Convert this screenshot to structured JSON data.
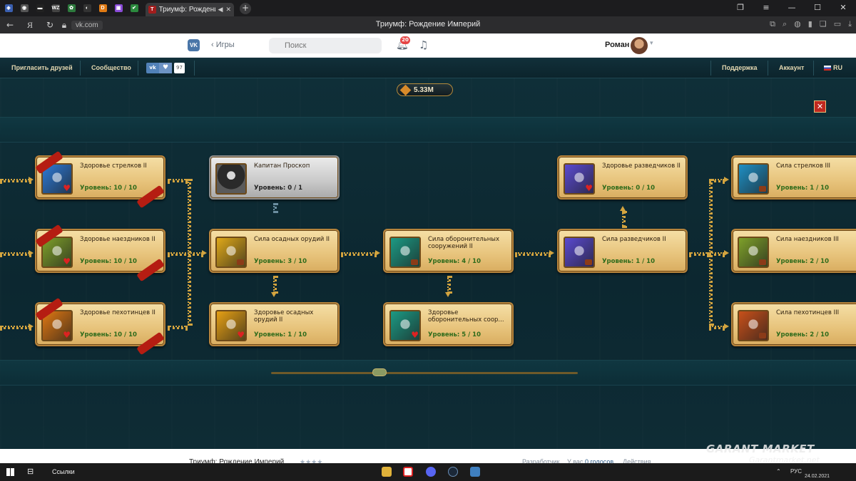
{
  "browser": {
    "pinned_tabs": [
      {
        "icon": "shield-icon",
        "glyph": "◈",
        "color": "#3a5fb0"
      },
      {
        "icon": "chrome-icon",
        "glyph": "◉",
        "color": "#555"
      },
      {
        "icon": "bar-icon",
        "glyph": "▬",
        "color": "#222"
      },
      {
        "icon": "wz-icon",
        "glyph": "WZ",
        "color": "#444"
      },
      {
        "icon": "leaf-icon",
        "glyph": "✿",
        "color": "#2d7a3d"
      },
      {
        "icon": "mask-icon",
        "glyph": "◐",
        "color": "#333"
      },
      {
        "icon": "dns-icon",
        "glyph": "DNS",
        "color": "#e07a13"
      },
      {
        "icon": "twitch-icon",
        "glyph": "▣",
        "color": "#8a4bd8"
      },
      {
        "icon": "check-icon",
        "glyph": "✔",
        "color": "#2b8a3e"
      }
    ],
    "active_tab_title": "Триумф: Рождение Империй",
    "url": "vk.com",
    "page_title": "Триумф: Рождение Империй"
  },
  "vk": {
    "logo": "VK",
    "back_label": "Игры",
    "search_placeholder": "Поиск",
    "notification_count": "20",
    "user_name": "Роман"
  },
  "game_nav": {
    "invite": "Пригласить друзей",
    "community": "Сообщество",
    "like_count": "97",
    "support": "Поддержка",
    "account": "Аккаунт",
    "lang": "RU"
  },
  "game": {
    "resource_value": "5.33M",
    "cards": [
      {
        "id": "c1",
        "name": "Здоровье стрелков II",
        "level": "Уровень: 10 / 10",
        "icon": "archers-health-icon",
        "bg": "#2e7ad6",
        "ribbon": true,
        "mini": "heart"
      },
      {
        "id": "c2",
        "name": "Здоровье наездников II",
        "level": "Уровень: 10 / 10",
        "icon": "riders-health-icon",
        "bg": "#7ea02a",
        "ribbon": true,
        "mini": "heart"
      },
      {
        "id": "c3",
        "name": "Здоровье пехотинцев II",
        "level": "Уровень: 10 / 10",
        "icon": "infantry-health-icon",
        "bg": "#e07812",
        "ribbon": true,
        "mini": "heart"
      },
      {
        "id": "c4",
        "name": "Капитан Проскоп",
        "level": "Уровень: 0 / 1",
        "icon": "hooded-captain-icon",
        "bg": "#4a4a4a",
        "gray": true
      },
      {
        "id": "c5",
        "name": "Сила осадных орудий II",
        "level": "Уровень: 3 / 10",
        "icon": "siege-power-icon",
        "bg": "#e0a91a",
        "mini": "stone"
      },
      {
        "id": "c6",
        "name": "Здоровье осадных орудий II",
        "level": "Уровень: 1 / 10",
        "icon": "siege-health-icon",
        "bg": "#e6a014",
        "mini": "heart"
      },
      {
        "id": "c7",
        "name": "Сила оборонительных сооружений II",
        "level": "Уровень: 4 / 10",
        "icon": "fortification-power-icon",
        "bg": "#1c9a84",
        "mini": "stone"
      },
      {
        "id": "c8",
        "name": "Здоровье оборонительных соор...",
        "level": "Уровень: 5 / 10",
        "icon": "fortification-health-icon",
        "bg": "#1c9a84",
        "mini": "heart"
      },
      {
        "id": "c9",
        "name": "Здоровье разведчиков II",
        "level": "Уровень: 0 / 10",
        "icon": "scouts-health-icon",
        "bg": "#5a4ad0",
        "mini": "heart"
      },
      {
        "id": "c10",
        "name": "Сила разведчиков II",
        "level": "Уровень: 1 / 10",
        "icon": "scouts-power-icon",
        "bg": "#5a4ad0",
        "mini": "stone"
      },
      {
        "id": "c11",
        "name": "Сила стрелков III",
        "level": "Уровень: 1 / 10",
        "icon": "archers-power-icon",
        "bg": "#1f8fc4",
        "mini": "stone"
      },
      {
        "id": "c12",
        "name": "Сила наездников III",
        "level": "Уровень: 2 / 10",
        "icon": "riders-power-icon",
        "bg": "#7ea02a",
        "mini": "stone"
      },
      {
        "id": "c13",
        "name": "Сила пехотинцев III",
        "level": "Уровень: 2 / 10",
        "icon": "infantry-power-icon",
        "bg": "#c8501a",
        "mini": "stone"
      }
    ]
  },
  "vk_footer": {
    "title": "Триумф: Рождение Империй",
    "developer": "Разработчик",
    "votes_prefix": "У вас",
    "votes": "0 голосов",
    "actions": "Действия"
  },
  "taskbar": {
    "links": "Ссылки",
    "lang": "РУС",
    "date": "24.02.2021"
  },
  "watermark": {
    "brand": "GARANT MARKET",
    "site": "Garantmarket.net"
  }
}
